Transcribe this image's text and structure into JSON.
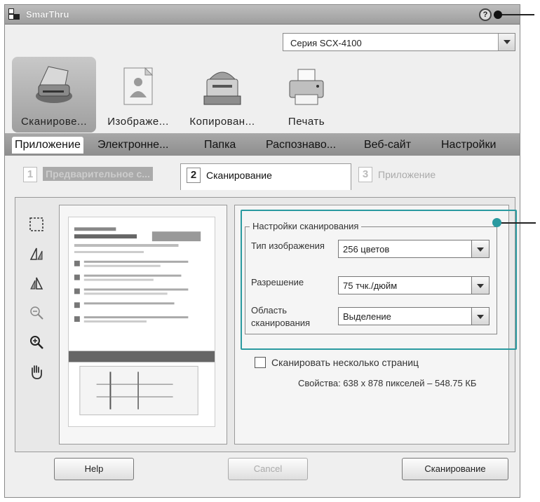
{
  "window": {
    "title": "SmarThru"
  },
  "model_select": {
    "value": "Серия SCX-4100"
  },
  "modes": [
    {
      "label": "Сканирове...",
      "icon": "scanner-icon"
    },
    {
      "label": "Изображе...",
      "icon": "image-icon"
    },
    {
      "label": "Копирован...",
      "icon": "copier-icon"
    },
    {
      "label": "Печать",
      "icon": "printer-icon"
    }
  ],
  "subtabs": [
    "Приложение",
    "Электронне...",
    "Папка",
    "Распознаво...",
    "Веб-сайт",
    "Настройки"
  ],
  "steps": [
    {
      "num": "1",
      "label": "Предварительное с..."
    },
    {
      "num": "2",
      "label": "Сканирование"
    },
    {
      "num": "3",
      "label": "Приложение"
    }
  ],
  "settings": {
    "legend": "Настройки сканирования",
    "image_type_label": "Тип изображения",
    "image_type_value": "256 цветов",
    "resolution_label": "Разрешение",
    "resolution_value": "75 тчк./дюйм",
    "area_label_1": "Область",
    "area_label_2": "сканирования",
    "area_value": "Выделение"
  },
  "multi_page_label": "Сканировать несколько страниц",
  "properties_text": "Свойства: 638 x 878 пикселей – 548.75 КБ",
  "buttons": {
    "help": "Help",
    "cancel": "Cancel",
    "scan": "Сканирование"
  },
  "colors": {
    "highlight": "#2a9aa0"
  }
}
